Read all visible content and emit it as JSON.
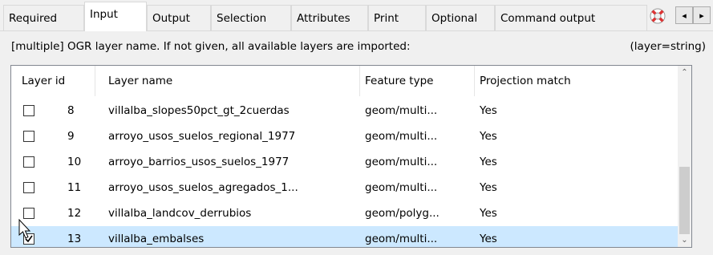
{
  "tabs": [
    {
      "label": "Required"
    },
    {
      "label": "Input",
      "active": true
    },
    {
      "label": "Output"
    },
    {
      "label": "Selection"
    },
    {
      "label": "Attributes"
    },
    {
      "label": "Print"
    },
    {
      "label": "Optional"
    },
    {
      "label": "Command output"
    }
  ],
  "tab_icon": "lifebuoy-icon",
  "tab_scroll": {
    "left": "◂",
    "right": "▸"
  },
  "description": "[multiple] OGR layer name. If not given, all available layers are imported:",
  "param_hint": "(layer=string)",
  "table": {
    "headers": {
      "layer_id": "Layer id",
      "layer_name": "Layer name",
      "feature_type": "Feature type",
      "projection_match": "Projection match"
    },
    "rows": [
      {
        "checked": false,
        "id": "8",
        "name": "villalba_slopes50pct_gt_2cuerdas",
        "type": "geom/multi...",
        "match": "Yes",
        "selected": false
      },
      {
        "checked": false,
        "id": "9",
        "name": "arroyo_usos_suelos_regional_1977",
        "type": "geom/multi...",
        "match": "Yes",
        "selected": false
      },
      {
        "checked": false,
        "id": "10",
        "name": "arroyo_barrios_usos_suelos_1977",
        "type": "geom/multi...",
        "match": "Yes",
        "selected": false
      },
      {
        "checked": false,
        "id": "11",
        "name": "arroyo_usos_suelos_agregados_1...",
        "type": "geom/multi...",
        "match": "Yes",
        "selected": false
      },
      {
        "checked": false,
        "id": "12",
        "name": "villalba_landcov_derrubios",
        "type": "geom/polyg...",
        "match": "Yes",
        "selected": false
      },
      {
        "checked": true,
        "id": "13",
        "name": "villalba_embalses",
        "type": "geom/multi...",
        "match": "Yes",
        "selected": true
      }
    ]
  },
  "scrollbar": {
    "up": "⌃",
    "down": "⌄"
  },
  "colors": {
    "selected_row": "#cce8ff",
    "border": "#828790"
  }
}
